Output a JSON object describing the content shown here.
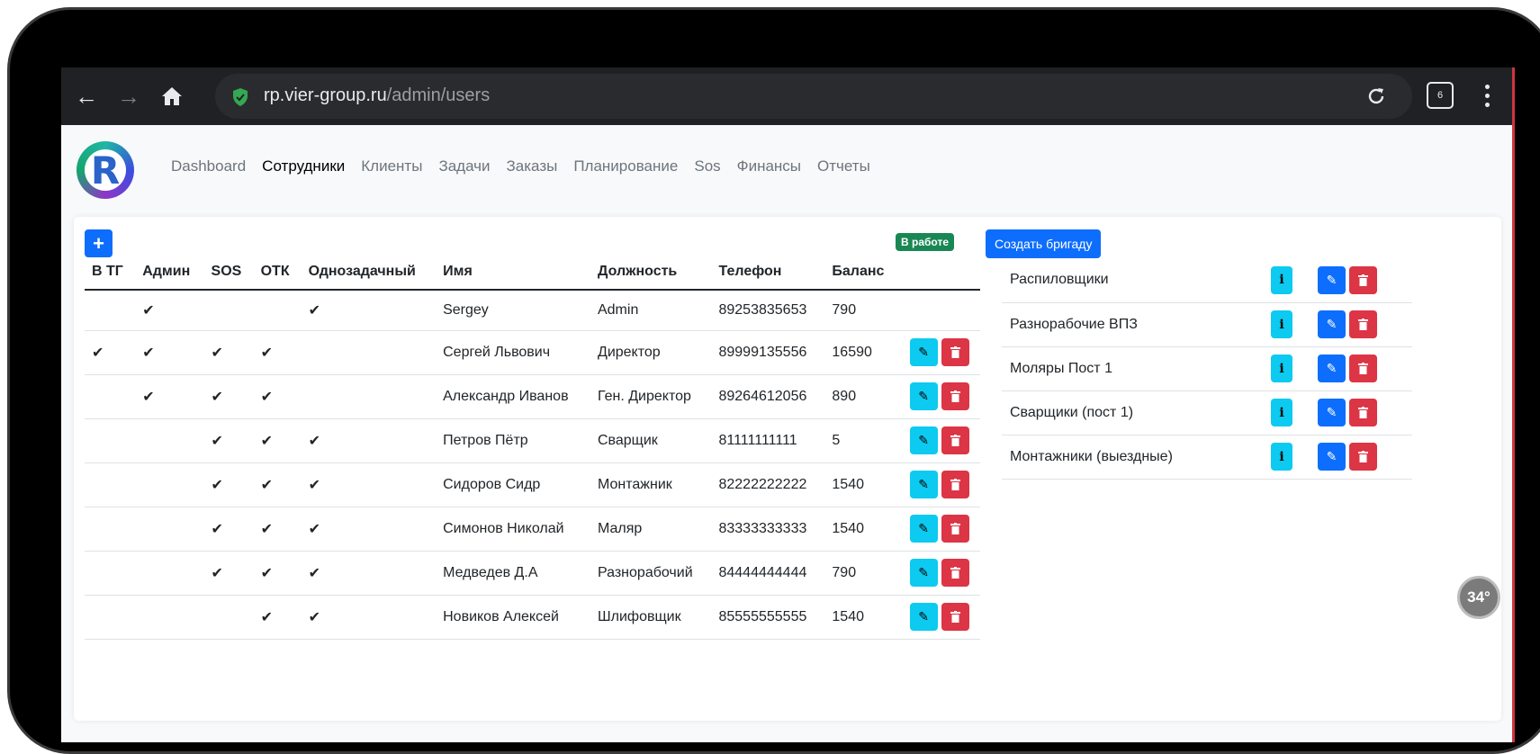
{
  "browser": {
    "url_domain": "rp.vier-group.ru",
    "url_path": "/admin/users",
    "tab_count": "6"
  },
  "nav": {
    "items": [
      "Dashboard",
      "Сотрудники",
      "Клиенты",
      "Задачи",
      "Заказы",
      "Планирование",
      "Sos",
      "Финансы",
      "Отчеты"
    ],
    "active": "Сотрудники"
  },
  "toolbar": {
    "add_label": "+",
    "status_badge": "В работе",
    "create_team_label": "Создать бригаду"
  },
  "users_table": {
    "columns": [
      "В ТГ",
      "Админ",
      "SOS",
      "ОТК",
      "Однозадачный",
      "Имя",
      "Должность",
      "Телефон",
      "Баланс"
    ],
    "rows": [
      {
        "tg": "",
        "admin": "✔",
        "sos": "",
        "otk": "",
        "single": "✔",
        "name": "Sergey",
        "position": "Admin",
        "phone": "89253835653",
        "balance": "790",
        "actions": false
      },
      {
        "tg": "✔",
        "admin": "✔",
        "sos": "✔",
        "otk": "✔",
        "single": "",
        "name": "Сергей Львович",
        "position": "Директор",
        "phone": "89999135556",
        "balance": "16590",
        "actions": true
      },
      {
        "tg": "",
        "admin": "✔",
        "sos": "✔",
        "otk": "✔",
        "single": "",
        "name": "Александр Иванов",
        "position": "Ген. Директор",
        "phone": "89264612056",
        "balance": "890",
        "actions": true
      },
      {
        "tg": "",
        "admin": "",
        "sos": "✔",
        "otk": "✔",
        "single": "✔",
        "name": "Петров Пётр",
        "position": "Сварщик",
        "phone": "81111111111",
        "balance": "5",
        "actions": true
      },
      {
        "tg": "",
        "admin": "",
        "sos": "✔",
        "otk": "✔",
        "single": "✔",
        "name": "Сидоров Сидр",
        "position": "Монтажник",
        "phone": "82222222222",
        "balance": "1540",
        "actions": true
      },
      {
        "tg": "",
        "admin": "",
        "sos": "✔",
        "otk": "✔",
        "single": "✔",
        "name": "Симонов Николай",
        "position": "Маляр",
        "phone": "83333333333",
        "balance": "1540",
        "actions": true
      },
      {
        "tg": "",
        "admin": "",
        "sos": "✔",
        "otk": "✔",
        "single": "✔",
        "name": "Медведев Д.А",
        "position": "Разнорабочий",
        "phone": "84444444444",
        "balance": "790",
        "actions": true
      },
      {
        "tg": "",
        "admin": "",
        "sos": "",
        "otk": "✔",
        "single": "✔",
        "name": "Новиков Алексей",
        "position": "Шлифовщик",
        "phone": "85555555555",
        "balance": "1540",
        "actions": true
      }
    ]
  },
  "teams": [
    "Распиловщики",
    "Разнорабочие ВПЗ",
    "Моляры Пост 1",
    "Сварщики (пост 1)",
    "Монтажники (выездные)"
  ],
  "overlay": {
    "temperature": "34°"
  },
  "colors": {
    "primary": "#0d6efd",
    "info": "#0dcaf0",
    "danger": "#dc3545",
    "success": "#198754",
    "browser_bar": "#202124"
  },
  "icons": {
    "back": "arrow-left-icon",
    "forward": "arrow-right-icon",
    "home": "home-icon",
    "secure": "shield-check-icon",
    "reload": "reload-icon",
    "tabs": "tab-switcher-icon",
    "menu": "more-vert-icon",
    "edit": "pencil-icon",
    "delete": "trash-icon",
    "info": "info-icon"
  }
}
